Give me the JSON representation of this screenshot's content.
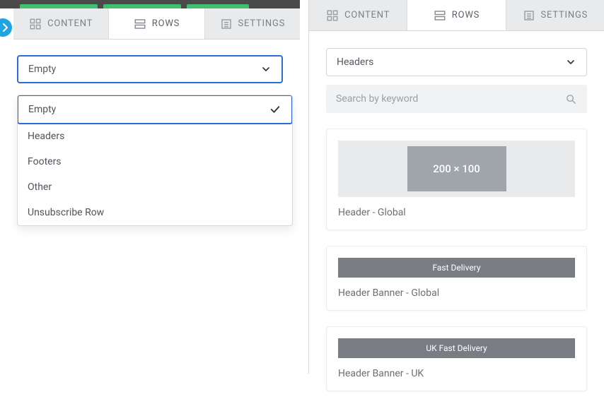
{
  "left": {
    "tabs": {
      "content": "CONTENT",
      "rows": "ROWS",
      "settings": "SETTINGS"
    },
    "select_value": "Empty",
    "dropdown": {
      "empty": "Empty",
      "headers": "Headers",
      "footers": "Footers",
      "other": "Other",
      "unsubscribe": "Unsubscribe Row"
    }
  },
  "right": {
    "tabs": {
      "content": "CONTENT",
      "rows": "ROWS",
      "settings": "SETTINGS"
    },
    "select_value": "Headers",
    "search_placeholder": "Search by keyword",
    "cards": {
      "c1": {
        "image_label": "200 × 100",
        "caption": "Header - Global"
      },
      "c2": {
        "bar_label": "Fast Delivery",
        "caption": "Header Banner - Global"
      },
      "c3": {
        "bar_label": "UK Fast Delivery",
        "caption": "Header Banner - UK"
      }
    }
  }
}
